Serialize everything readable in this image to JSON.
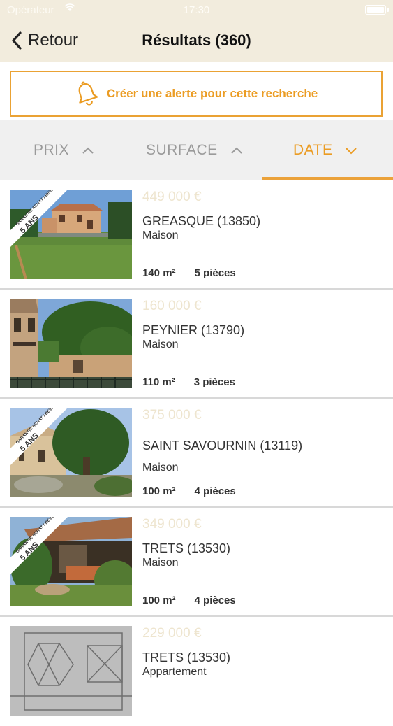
{
  "status_bar": {
    "carrier": "Opérateur",
    "time": "17:30"
  },
  "header": {
    "back_label": "Retour",
    "title": "Résultats (360)"
  },
  "alert": {
    "label": "Créer une alerte pour cette recherche"
  },
  "sort": {
    "tabs": [
      {
        "label": "PRIX",
        "direction": "up",
        "active": false
      },
      {
        "label": "SURFACE",
        "direction": "up",
        "active": false
      },
      {
        "label": "DATE",
        "direction": "down",
        "active": true
      }
    ]
  },
  "listings": [
    {
      "price": "449 000 €",
      "city": "GREASQUE (13850)",
      "type": "Maison",
      "surface": "140 m²",
      "rooms": "5 pièces",
      "badge": true,
      "badge_lines": [
        "GARANTIE ACHAT / REVENTE",
        "5 ANS"
      ]
    },
    {
      "price": "160 000 €",
      "city": "PEYNIER (13790)",
      "type": "Maison",
      "surface": "110 m²",
      "rooms": "3 pièces",
      "badge": false
    },
    {
      "price": "375 000 €",
      "city": "SAINT SAVOURNIN (13119)",
      "type": "Maison",
      "surface": "100 m²",
      "rooms": "4 pièces",
      "badge": true,
      "badge_lines": [
        "GARANTIE ACHAT / REVENTE",
        "5 ANS"
      ]
    },
    {
      "price": "349 000 €",
      "city": "TRETS (13530)",
      "type": "Maison",
      "surface": "100 m²",
      "rooms": "4 pièces",
      "badge": true,
      "badge_lines": [
        "GARANTIE ACHAT / REVENTE",
        "5 ANS"
      ]
    },
    {
      "price": "229 000 €",
      "city": "TRETS (13530)",
      "type": "Appartement",
      "surface": "",
      "rooms": "",
      "badge": false
    }
  ],
  "colors": {
    "accent": "#eb9c23",
    "header_bg": "#f2ecdd",
    "price": "#eee5cf"
  }
}
